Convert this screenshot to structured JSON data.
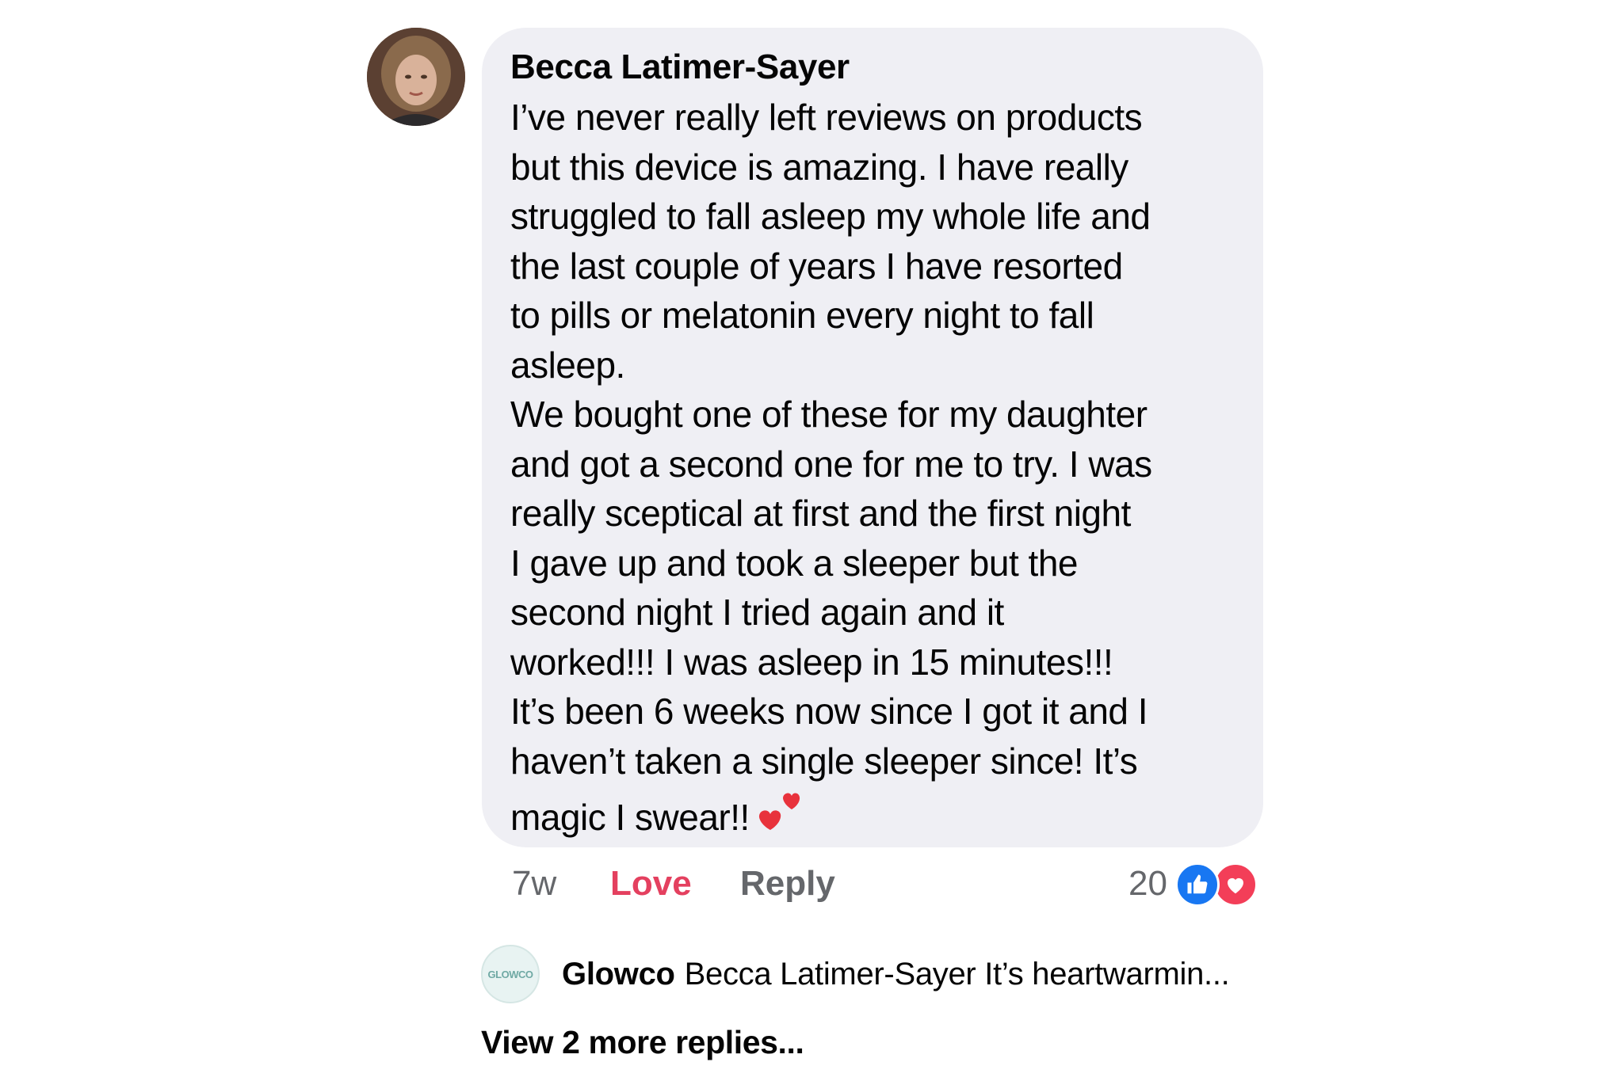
{
  "comment": {
    "author": "Becca Latimer-Sayer",
    "avatar_icon": "profile-photo",
    "body": "I’ve never really left reviews on products\nbut this device is amazing. I have really\nstruggled to fall asleep my whole life and\nthe last couple of years I have resorted\nto pills or melatonin every night to fall\nasleep.\nWe bought one of these for my daughter\nand got a second one for me to try. I was\nreally sceptical at first and the first night\nI gave up and took a sleeper but the\nsecond night I tried again and it\nworked!!! I was asleep in 15 minutes!!!\nIt’s been 6 weeks now since I got it and I\nhaven’t taken a single sleeper since! It’s\nmagic I swear!!",
    "trailing_emoji": "two-hearts-icon",
    "time": "7w",
    "love_label": "Love",
    "reply_label": "Reply",
    "reaction_count": "20",
    "reaction_icons": [
      "like-icon",
      "heart-icon"
    ],
    "colors": {
      "bubble": "#efeff4",
      "love": "#e4405f",
      "like": "#1877f2",
      "heart": "#f33e58"
    }
  },
  "reply": {
    "avatar_text": "GLOWCO",
    "author": "Glowco",
    "preview": "Becca Latimer-Sayer It’s heartwarmin..."
  },
  "view_more_label": "View 2 more replies..."
}
